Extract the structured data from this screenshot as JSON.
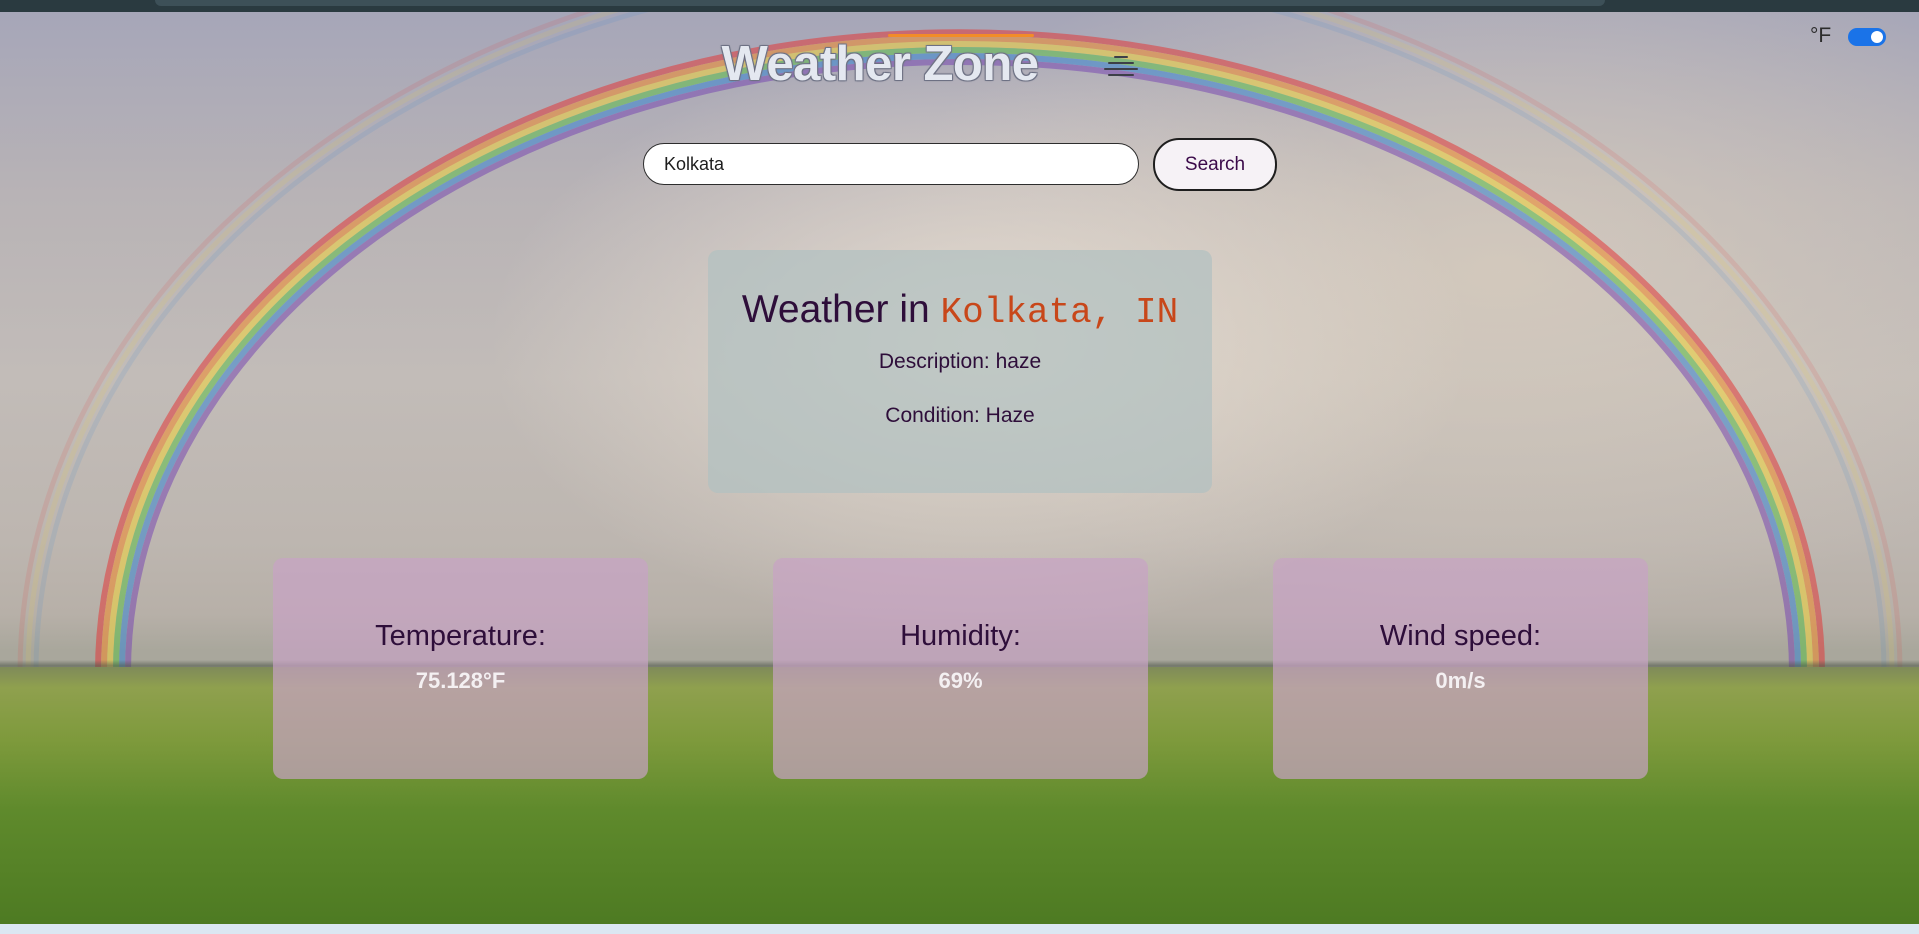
{
  "app": {
    "title": "Weather Zone",
    "title_icon": "haze-lines-icon"
  },
  "units": {
    "label": "°F",
    "toggle_on": true,
    "accent": "#1a73e8"
  },
  "search": {
    "value": "Kolkata",
    "button_label": "Search"
  },
  "weather": {
    "heading_prefix": "Weather in",
    "location": "Kolkata, IN",
    "description": "Description: haze",
    "condition": "Condition: Haze"
  },
  "stats": [
    {
      "label": "Temperature:",
      "value": "75.128°F"
    },
    {
      "label": "Humidity:",
      "value": "69%"
    },
    {
      "label": "Wind speed:",
      "value": "0m/s"
    }
  ],
  "colors": {
    "heading": "#2e0e3a",
    "city": "#c8471a",
    "stat_card": "#c8a2c4",
    "main_card": "#b2c0c0"
  }
}
